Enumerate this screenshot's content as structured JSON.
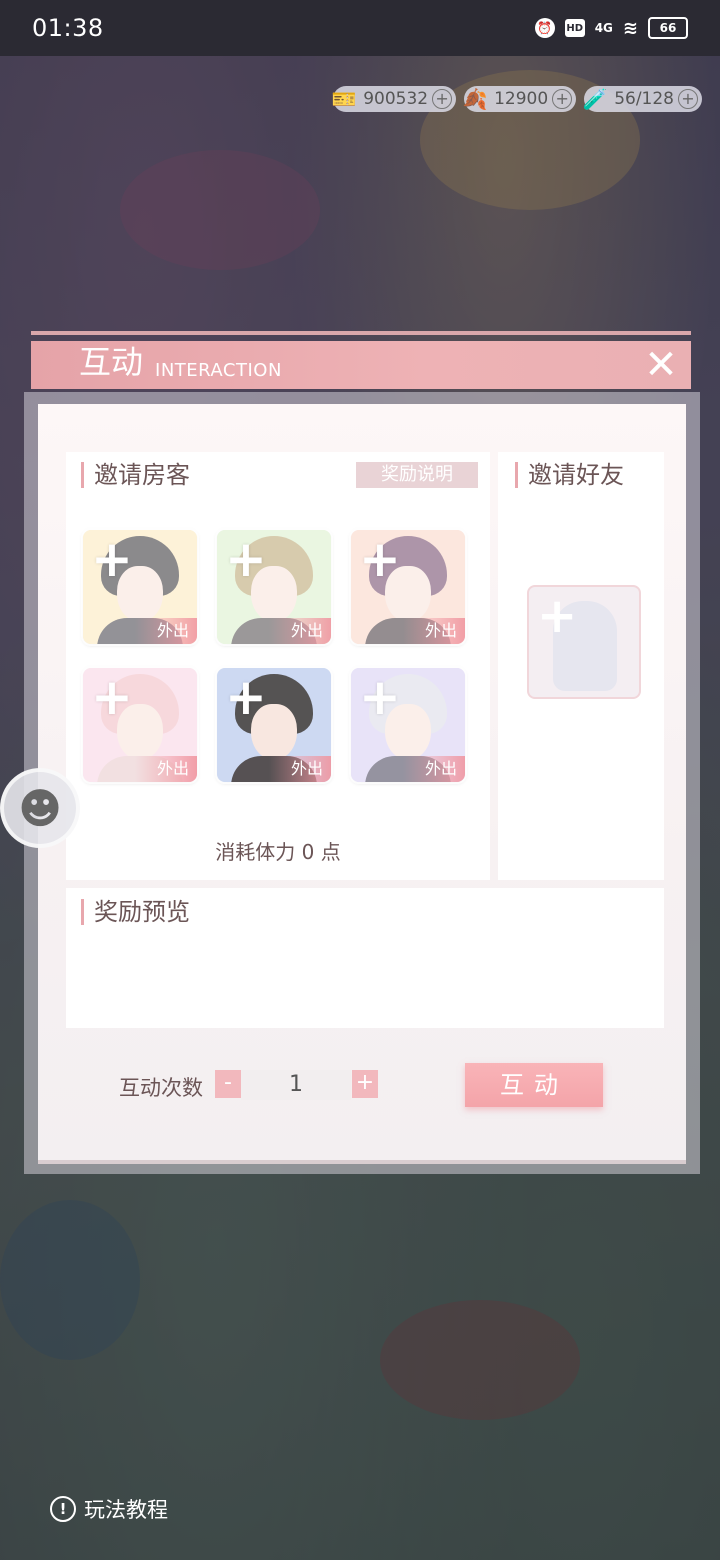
{
  "status_bar": {
    "time": "01:38",
    "hd": "HD",
    "network": "4G",
    "battery": "66"
  },
  "resources": [
    {
      "icon": "ticket-icon",
      "value": "900532"
    },
    {
      "icon": "gold-leaf-icon",
      "value": "12900"
    },
    {
      "icon": "energy-bottle-icon",
      "value": "56/128"
    }
  ],
  "dialog": {
    "title": "互动",
    "subtitle": "INTERACTION",
    "invite_guests": {
      "label": "邀请房客",
      "reward_info_button": "奖励说明",
      "slots": [
        {
          "status": "外出"
        },
        {
          "status": "外出"
        },
        {
          "status": "外出"
        },
        {
          "status": "外出"
        },
        {
          "status": "外出"
        },
        {
          "status": "外出"
        }
      ],
      "stamina_text": "消耗体力 0  点"
    },
    "invite_friends": {
      "label": "邀请好友"
    },
    "reward_preview": {
      "label": "奖励预览"
    },
    "interaction_count": {
      "label": "互动次数",
      "minus": "-",
      "value": "1",
      "plus": "+"
    },
    "interact_button": "互动"
  },
  "tutorial": {
    "label": "玩法教程",
    "icon": "!"
  },
  "colors": {
    "accent_pink": "#f4a4a9",
    "header_pink": "#e5a3a8",
    "text_brown": "#6b5556"
  }
}
